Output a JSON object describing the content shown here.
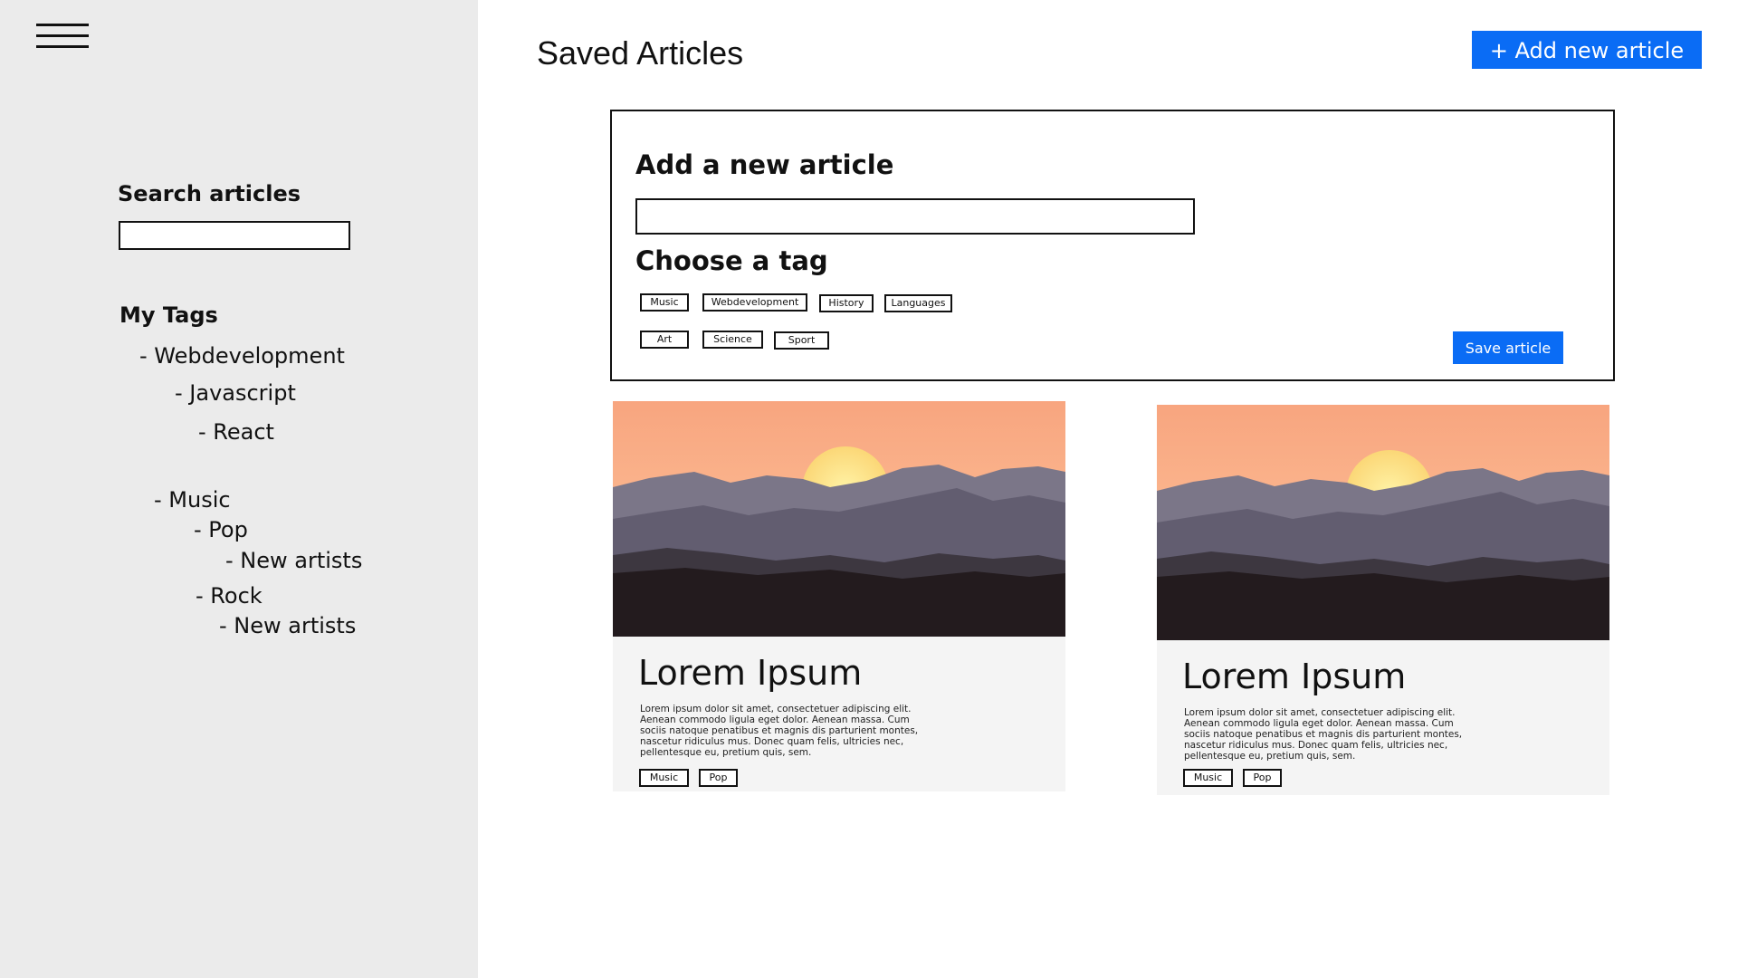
{
  "sidebar": {
    "search_label": "Search articles",
    "search_value": "",
    "tags_title": "My Tags",
    "tree": [
      "- Webdevelopment",
      "- Javascript",
      "- React",
      "- Music",
      "- Pop",
      "- New artists",
      "- Rock",
      "- New artists"
    ]
  },
  "header": {
    "title": "Saved Articles",
    "add_button": "+ Add new article"
  },
  "form": {
    "heading": "Add a new article",
    "title_value": "",
    "tag_heading": "Choose a tag",
    "tags": [
      "Music",
      "Webdevelopment",
      "History",
      "Languages",
      "Art",
      "Science",
      "Sport"
    ],
    "save_button": "Save article"
  },
  "cards": [
    {
      "title": "Lorem Ipsum",
      "body": "Lorem ipsum dolor sit amet, consectetuer adipiscing elit. Aenean commodo ligula eget dolor. Aenean massa. Cum sociis natoque penatibus et magnis dis parturient montes, nascetur ridiculus mus. Donec quam felis, ultricies nec, pellentesque eu, pretium quis, sem.",
      "tags": [
        "Music",
        "Pop"
      ]
    },
    {
      "title": "Lorem Ipsum",
      "body": "Lorem ipsum dolor sit amet, consectetuer adipiscing elit. Aenean commodo ligula eget dolor. Aenean massa. Cum sociis natoque penatibus et magnis dis parturient montes, nascetur ridiculus mus. Donec quam felis, ultricies nec, pellentesque eu, pretium quis, sem.",
      "tags": [
        "Music",
        "Pop"
      ]
    }
  ],
  "icons": {
    "menu": "hamburger-menu-icon",
    "card_image": "sunset-mountains-image"
  },
  "colors": {
    "accent": "#0a6cf5",
    "sidebar_bg": "#ebebeb",
    "card_bg": "#f4f4f4"
  }
}
